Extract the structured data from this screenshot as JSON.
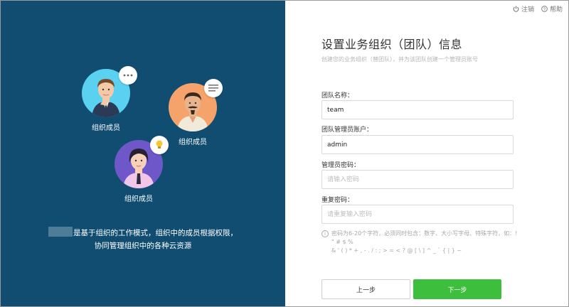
{
  "topbar": {
    "logout_label": "注销",
    "help_label": "帮助"
  },
  "left": {
    "members": [
      {
        "label": "组织成员",
        "icon": "businessman-avatar-icon",
        "bubble_icon": "ellipsis-bubble-icon"
      },
      {
        "label": "组织成员",
        "icon": "mustache-man-avatar-icon",
        "bubble_icon": "message-lines-bubble-icon"
      },
      {
        "label": "组织成员",
        "icon": "woman-avatar-icon",
        "bubble_icon": "lightbulb-bubble-icon"
      }
    ],
    "description_line1": "是基于组织的工作模式，组织中的成员根据权限，",
    "description_line2": "协同管理组织中的各种云资源",
    "colors": {
      "panel_bg": "#104d71",
      "avatar1_bg": "#5ad1f0",
      "avatar2_bg": "#f5a36b",
      "avatar3_bg": "#6d57c9"
    }
  },
  "form": {
    "title": "设置业务组织（团队）信息",
    "subtitle": "创建您的业务组织（替团队），并为该团队创建一个管理员账号",
    "team_name": {
      "label": "团队名称：",
      "value": "team"
    },
    "admin_account": {
      "label": "团队管理员账户：",
      "value": "admin"
    },
    "admin_password": {
      "label": "管理员密码：",
      "placeholder": "请输入密码"
    },
    "repeat_password": {
      "label": "重复密码：",
      "placeholder": "请重复输入密码"
    },
    "hint_line1": "密码为6-20个字符，必须同时包含：数字、大小写字母、特殊字符，如：! \" # $ %",
    "hint_line2": "& ' ( ) * + , - . / : ; > = < ? @ [ \\ ] ^ _ ` { | } ~",
    "prev_label": "上一步",
    "next_label": "下一步",
    "colors": {
      "accent": "#3dbf3d"
    }
  }
}
